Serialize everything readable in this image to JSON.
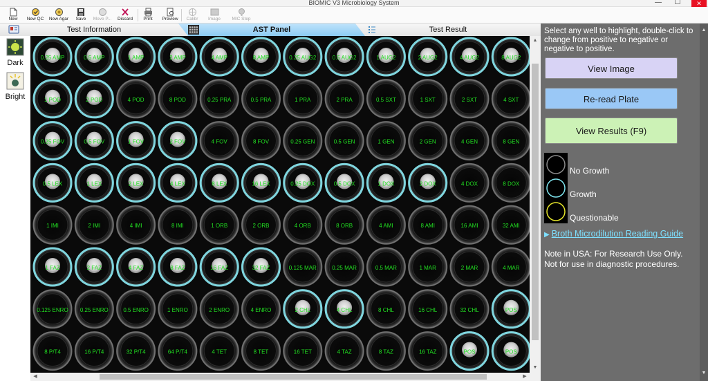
{
  "window": {
    "title": "BIOMIC V3 Microbiology System",
    "minimize": "—",
    "maximize": "☐",
    "close": "✕"
  },
  "toolbar": {
    "new": "New",
    "new_qc": "New QC",
    "new_agar": "New Agar",
    "save": "Save",
    "move_p": "Move P...",
    "discard": "Discard",
    "print": "Print",
    "preview": "Preview",
    "calibr": "Calibr",
    "image": "Image",
    "mic_step": "MIC Step",
    "disabled": [
      "move_p",
      "calibr",
      "image",
      "mic_step"
    ]
  },
  "tabs": {
    "test_information": "Test Information",
    "ast_panel": "AST Panel",
    "test_result": "Test Result",
    "active": "ast_panel"
  },
  "view_modes": {
    "dark": "Dark",
    "bright": "Bright"
  },
  "plate": {
    "rows": [
      [
        "0.25 AMP",
        "0.5 AMP",
        "1 AMP",
        "2 AMP",
        "4 AMP",
        "8 AMP",
        "0.25 AUG2",
        "0.5 AUG2",
        "1 AUG2",
        "2 AUG2",
        "4 AUG2",
        "8 AUG2"
      ],
      [
        "1 POD",
        "2 POD",
        "4 POD",
        "8 POD",
        "0.25 PRA",
        "0.5 PRA",
        "1 PRA",
        "2 PRA",
        "0.5 SXT",
        "1 SXT",
        "2 SXT",
        "4 SXT"
      ],
      [
        "0.25 FOV",
        "0.5 FOV",
        "1 FOV",
        "2 FOV",
        "4 FOV",
        "8 FOV",
        "0.25 GEN",
        "0.5 GEN",
        "1 GEN",
        "2 GEN",
        "4 GEN",
        "8 GEN"
      ],
      [
        "0.5 LEX",
        "1 LEX",
        "2 LEX",
        "4 LEX",
        "8 LEX",
        "16 LEX",
        "0.25 DOX",
        "0.5 DOX",
        "1 DOX",
        "2 DOX",
        "4 DOX",
        "8 DOX"
      ],
      [
        "1 IMI",
        "2 IMI",
        "4 IMI",
        "8 IMI",
        "1 ORB",
        "2 ORB",
        "4 ORB",
        "8 ORB",
        "4 AMI",
        "8 AMI",
        "16 AMI",
        "32 AMI"
      ],
      [
        "1 FAZ",
        "2 FAZ",
        "4 FAZ",
        "8 FAZ",
        "16 FAZ",
        "32 FAZ",
        "0.125 MAR",
        "0.25 MAR",
        "0.5 MAR",
        "1 MAR",
        "2 MAR",
        "4 MAR"
      ],
      [
        "0.125 ENRO",
        "0.25 ENRO",
        "0.5 ENRO",
        "1 ENRO",
        "2 ENRO",
        "4 ENRO",
        "2 CHL",
        "4 CHL",
        "8 CHL",
        "16 CHL",
        "32 CHL",
        "POS"
      ],
      [
        "8 P/T4",
        "16 P/T4",
        "32 P/T4",
        "64 P/T4",
        "4 TET",
        "8 TET",
        "16 TET",
        "4 TAZ",
        "8 TAZ",
        "16 TAZ",
        "POS",
        "POS"
      ]
    ],
    "growth": [
      [
        1,
        1,
        1,
        1,
        1,
        1,
        1,
        1,
        1,
        1,
        1,
        1
      ],
      [
        1,
        1,
        0,
        0,
        0,
        0,
        0,
        0,
        0,
        0,
        0,
        0
      ],
      [
        1,
        1,
        1,
        1,
        0,
        0,
        0,
        0,
        0,
        0,
        0,
        0
      ],
      [
        1,
        1,
        1,
        1,
        1,
        1,
        1,
        1,
        1,
        1,
        0,
        0
      ],
      [
        0,
        0,
        0,
        0,
        0,
        0,
        0,
        0,
        0,
        0,
        0,
        0
      ],
      [
        1,
        1,
        1,
        1,
        1,
        1,
        0,
        0,
        0,
        0,
        0,
        0
      ],
      [
        0,
        0,
        0,
        0,
        0,
        0,
        1,
        1,
        0,
        0,
        0,
        1
      ],
      [
        0,
        0,
        0,
        0,
        0,
        0,
        0,
        0,
        0,
        0,
        1,
        1
      ]
    ],
    "growth_ring_color": "#7fd6df",
    "label_color": "#22e022"
  },
  "panel": {
    "instructions": "Select any well to highlight, double-click to change from positive to negative or negative to positive.",
    "buttons": {
      "view_image": "View Image",
      "reread_plate": "Re-read Plate",
      "view_results": "View Results (F9)"
    },
    "legend": [
      {
        "label": "No Growth",
        "ring_color": "#8a8a8a"
      },
      {
        "label": "Growth",
        "ring_color": "#7fe6f0"
      },
      {
        "label": "Questionable",
        "ring_color": "#e6e62a"
      }
    ],
    "guide_link": "Broth Microdilution Reading Guide",
    "note": "Note in USA: For Research Use Only. Not for use in diagnostic procedures."
  }
}
